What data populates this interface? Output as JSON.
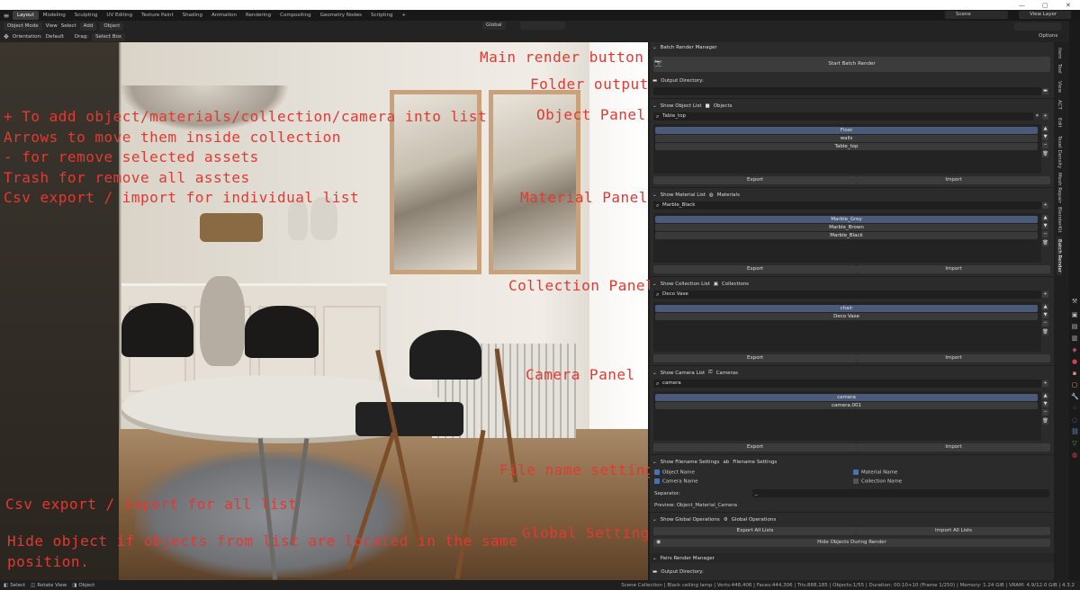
{
  "topbar": {
    "workspace_tabs": [
      "Layout",
      "Modeling",
      "Sculpting",
      "UV Editing",
      "Texture Paint",
      "Shading",
      "Animation",
      "Rendering",
      "Compositing",
      "Geometry Nodes",
      "Scripting"
    ],
    "add_tab": "+",
    "scene": "Scene",
    "view_layer": "View Layer"
  },
  "header": {
    "mode": "Object Mode",
    "menus": [
      "View",
      "Select",
      "Add",
      "Object"
    ],
    "orientation_label": "Orientation:",
    "orientation_value": "Default",
    "drag_label": "Drag:",
    "drag_value": "Select Box",
    "transform": "Global",
    "options": "Options"
  },
  "annotations": {
    "left": [
      "+ To add object/materials/collection/camera into list",
      "Arrows to move them inside collection",
      "- for remove selected assets",
      "Trash for remove all asstes",
      "Csv export / import for individual list"
    ],
    "csv_all": "Csv export / import for all list",
    "hide_note_1": "Hide object if objects from list are located in the same",
    "hide_note_2": "position.",
    "main_render": "Main render button",
    "folder_output": "Folder output",
    "object_panel": "Object Panel",
    "material_panel": "Material Panel",
    "collection_panel": "Collection Panel",
    "camera_panel": "Camera Panel",
    "file_name": "File name setting",
    "global_settings": "Global Settings"
  },
  "panel": {
    "title": "Batch Render Manager",
    "start_button": "Start Batch Render",
    "output_label": "Output Directory:",
    "object_section": {
      "toggle": "Show Object List",
      "type": "Objects",
      "search": "Table_top",
      "items": [
        "Floor",
        "walls",
        "Table_top"
      ],
      "export": "Export",
      "import": "Import"
    },
    "material_section": {
      "toggle": "Show Material List",
      "type": "Materials",
      "search": "Marble_Black",
      "items": [
        "Marble_Grey",
        "Marble_Brown",
        "Marble_Black"
      ],
      "export": "Export",
      "import": "Import"
    },
    "collection_section": {
      "toggle": "Show Collection List",
      "type": "Collections",
      "search": "Deco Vase",
      "items": [
        "chair",
        "Deco Vase"
      ],
      "export": "Export",
      "import": "Import"
    },
    "camera_section": {
      "toggle": "Show Camera List",
      "type": "Cameras",
      "search": "camera",
      "items": [
        "camera",
        "camera.001"
      ],
      "export": "Export",
      "import": "Import"
    },
    "filename_section": {
      "toggle": "Show Filename Settings",
      "type": "Filename Settings",
      "object_name": "Object Name",
      "material_name": "Material Name",
      "camera_name": "Camera Name",
      "collection_name": "Collection Name",
      "separator_label": "Separator:",
      "separator_value": "_",
      "preview": "Preview: Object_Material_Camera"
    },
    "global_section": {
      "toggle": "Show Global Operations",
      "type": "Global Operations",
      "export_all": "Export All Lists",
      "import_all": "Import All Lists",
      "hide_objects": "Hide Objects During Render"
    },
    "pairs_title": "Pairs Render Manager",
    "pairs_output": "Output Directory:"
  },
  "vtabs": [
    "Item",
    "Tool",
    "View",
    "ACT",
    "Edit",
    "Texel Density",
    "Mesh Repair",
    "BlenderKit",
    "Batch Render"
  ],
  "status": {
    "select": "Select",
    "rotate": "Rotate View",
    "object": "Object",
    "info": "Scene Collection | Black ceiling lamp | Verts:448,406 | Faces:444,306 | Tris:888,185 | Objects:1/55 | Duration: 00:10+10 (Frame 1/250) | Memory: 1.24 GiB | VRAM: 4.9/12.0 GiB | 4.3.2"
  }
}
